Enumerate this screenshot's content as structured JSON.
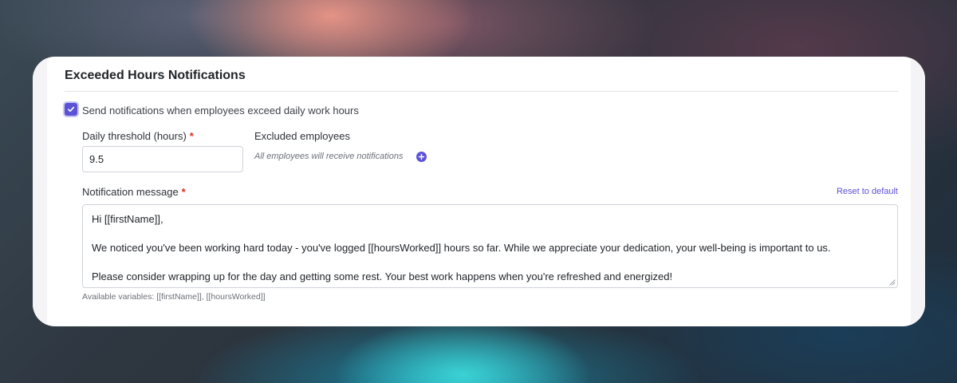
{
  "section": {
    "title": "Exceeded Hours Notifications"
  },
  "notify": {
    "checked": true,
    "label": "Send notifications when employees exceed daily work hours"
  },
  "threshold": {
    "label": "Daily threshold (hours)",
    "required_mark": "*",
    "value": "9.5"
  },
  "excluded": {
    "label": "Excluded employees",
    "empty_text": "All employees will receive notifications",
    "add_icon": "plus-circle-icon"
  },
  "message": {
    "label": "Notification message",
    "required_mark": "*",
    "reset_label": "Reset to default",
    "lines": [
      "Hi [[firstName]],",
      "We noticed you've been working hard today - you've logged [[hoursWorked]] hours so far. While we appreciate your dedication, your well-being is important to us.",
      "Please consider wrapping up for the day and getting some rest. Your best work happens when you're refreshed and energized!"
    ],
    "variables_hint": "Available variables: [[firstName]], [[hoursWorked]]"
  },
  "colors": {
    "accent": "#5b52d6",
    "required": "#d92d20"
  }
}
